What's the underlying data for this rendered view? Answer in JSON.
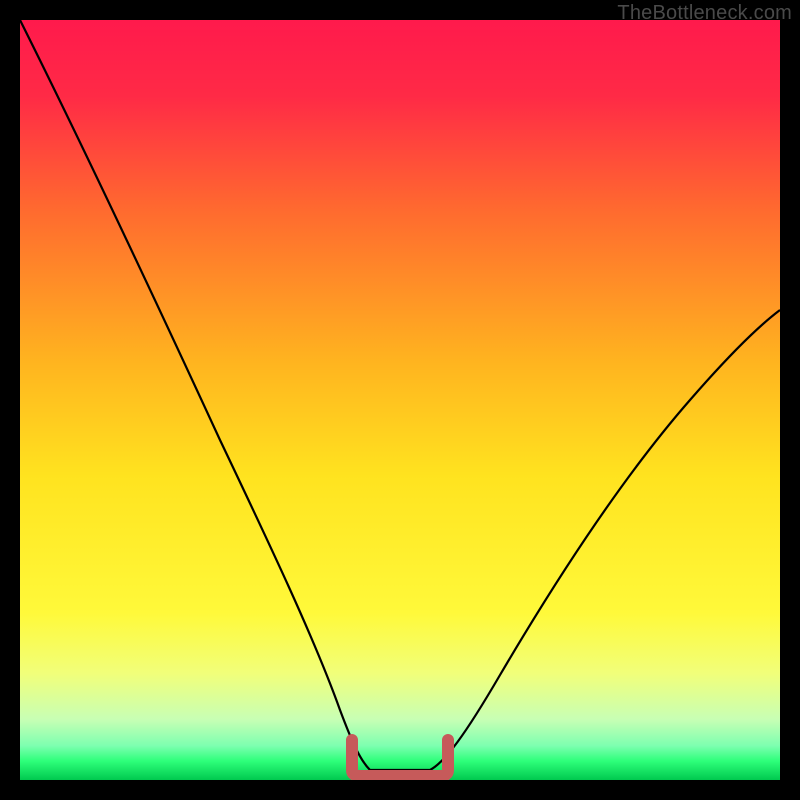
{
  "watermark": "TheBottleneck.com",
  "palette": {
    "black": "#000000",
    "curve_stroke": "#000000",
    "marker_stroke": "#c65a5a",
    "grad_top": "#ff1a4c",
    "grad_mid_upper": "#ff6a2f",
    "grad_mid": "#ffd21f",
    "grad_lower": "#f7ff6a",
    "grad_green": "#2eff7a",
    "grad_green_deep": "#00c94f"
  },
  "chart_data": {
    "type": "line",
    "title": "",
    "xlabel": "",
    "ylabel": "",
    "xlim": [
      0,
      100
    ],
    "ylim": [
      0,
      100
    ],
    "series": [
      {
        "name": "bottleneck-curve",
        "x": [
          0,
          5,
          10,
          15,
          20,
          25,
          30,
          35,
          38,
          40,
          42,
          44,
          46,
          49,
          53,
          56,
          60,
          65,
          70,
          75,
          80,
          85,
          90,
          95,
          100
        ],
        "y": [
          100,
          90,
          80,
          70,
          60,
          50,
          40,
          29,
          20,
          13,
          7,
          3,
          1,
          0.5,
          0.5,
          1,
          4,
          10,
          18,
          26,
          34,
          42,
          50,
          56,
          61
        ]
      }
    ],
    "flat_region": {
      "x_start": 44,
      "x_end": 56,
      "y": 0.5
    }
  }
}
